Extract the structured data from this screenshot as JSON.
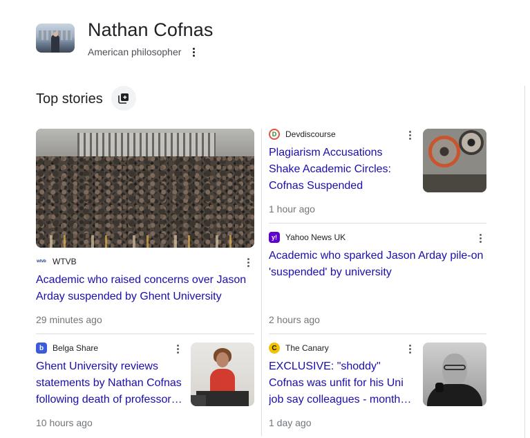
{
  "entity": {
    "name": "Nathan Cofnas",
    "description": "American philosopher"
  },
  "section": {
    "title": "Top stories"
  },
  "stories": [
    {
      "source": "WTVB",
      "favicon_text": "wtvb",
      "headline": "Academic who raised concerns over Jason Arday suspended by Ghent University",
      "time": "29 minutes ago"
    },
    {
      "source": "Devdiscourse",
      "favicon_text": "D",
      "headline": "Plagiarism Accusations Shake Academic Circles: Cofnas Suspended",
      "time": "1 hour ago"
    },
    {
      "source": "Yahoo News UK",
      "favicon_text": "y!",
      "headline": "Academic who sparked Jason Arday pile-on 'suspended' by university",
      "time": "2 hours ago"
    },
    {
      "source": "Belga Share",
      "favicon_text": "b",
      "headline": "Ghent University reviews statements by Nathan Cofnas following death of professor…",
      "time": "10 hours ago"
    },
    {
      "source": "The Canary",
      "favicon_text": "C",
      "headline": "EXCLUSIVE: \"shoddy\" Cofnas was unfit for his Uni job say colleagues - month…",
      "time": "1 day ago"
    }
  ],
  "colors": {
    "link": "#1a0dab",
    "divider": "#dadce0",
    "yahoo": "#6001d2",
    "belga": "#3b5bdb",
    "canary": "#f2c200"
  }
}
